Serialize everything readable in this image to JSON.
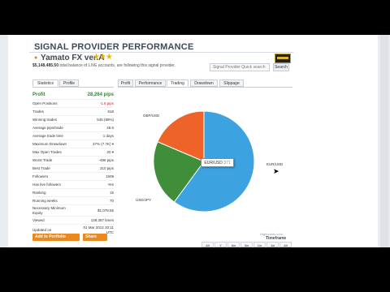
{
  "page": {
    "title": "SIGNAL PROVIDER PERFORMANCE",
    "provider_name": "Yamato FX ver.A",
    "stars": "★★★",
    "balance": "$5,148,485.50",
    "balance_text": "total balance of LIVE accounts, are following this signal provider.",
    "search_placeholder": "Signal Provider Quick search",
    "search_button": "Search"
  },
  "left_tabs": [
    {
      "label": "Statistics",
      "active": true
    },
    {
      "label": "Profile",
      "active": false
    }
  ],
  "main_tabs": [
    {
      "label": "Profit",
      "active": false
    },
    {
      "label": "Performance",
      "active": false
    },
    {
      "label": "Trading",
      "active": true
    },
    {
      "label": "Drawdown",
      "active": false
    },
    {
      "label": "Slippage",
      "active": false
    }
  ],
  "stats": {
    "profit_label": "Profit",
    "profit_value": "28,264 pips",
    "rows": [
      {
        "label": "Open Positions",
        "value": "-1.6 pips",
        "red": true
      },
      {
        "label": "Trades",
        "value": "618"
      },
      {
        "label": "Winning trades",
        "value": "545 (88%)"
      },
      {
        "label": "Average pips/trade",
        "value": "46.6"
      },
      {
        "label": "Average trade time",
        "value": "1 days"
      },
      {
        "label": "Maximum Drawdown",
        "value": "27% (7.7K) ▾"
      },
      {
        "label": "Max Open Trades",
        "value": "20 ▾"
      },
      {
        "label": "Worst Trade",
        "value": "-486 pips"
      },
      {
        "label": "Best Trade",
        "value": "310 pips"
      },
      {
        "label": "Followers",
        "value": "1509"
      },
      {
        "label": "Has live followers",
        "value": "Yes"
      },
      {
        "label": "Ranking",
        "value": "15"
      },
      {
        "label": "Running weeks",
        "value": "70"
      },
      {
        "label": "Necessary Minimum Equity",
        "value": "$1,078.55",
        "tall": true
      },
      {
        "label": "Viewed",
        "value": "128,387 times"
      },
      {
        "label": "Updated on",
        "value": "01 Mar 2012 20:11 UTC",
        "tall": true
      }
    ]
  },
  "buttons": {
    "add_portfolio": "Add to Portfolio",
    "share": "Share"
  },
  "chart_data": {
    "type": "pie",
    "title": "",
    "slices": [
      {
        "label": "EUR/USD",
        "value": 371,
        "color": "#3da3e0"
      },
      {
        "label": "USD/JPY",
        "value": 132,
        "color": "#3f8e3a"
      },
      {
        "label": "GBP/USD",
        "value": 115,
        "color": "#ee6327"
      }
    ],
    "tooltip_label": "EUR/USD",
    "tooltip_value": "371"
  },
  "footer": {
    "credit": "Highcharts.com",
    "timeframe": "Timeframe",
    "periods": [
      "All",
      "Y",
      "6m",
      "3m",
      "1m",
      "1w",
      "All"
    ]
  }
}
